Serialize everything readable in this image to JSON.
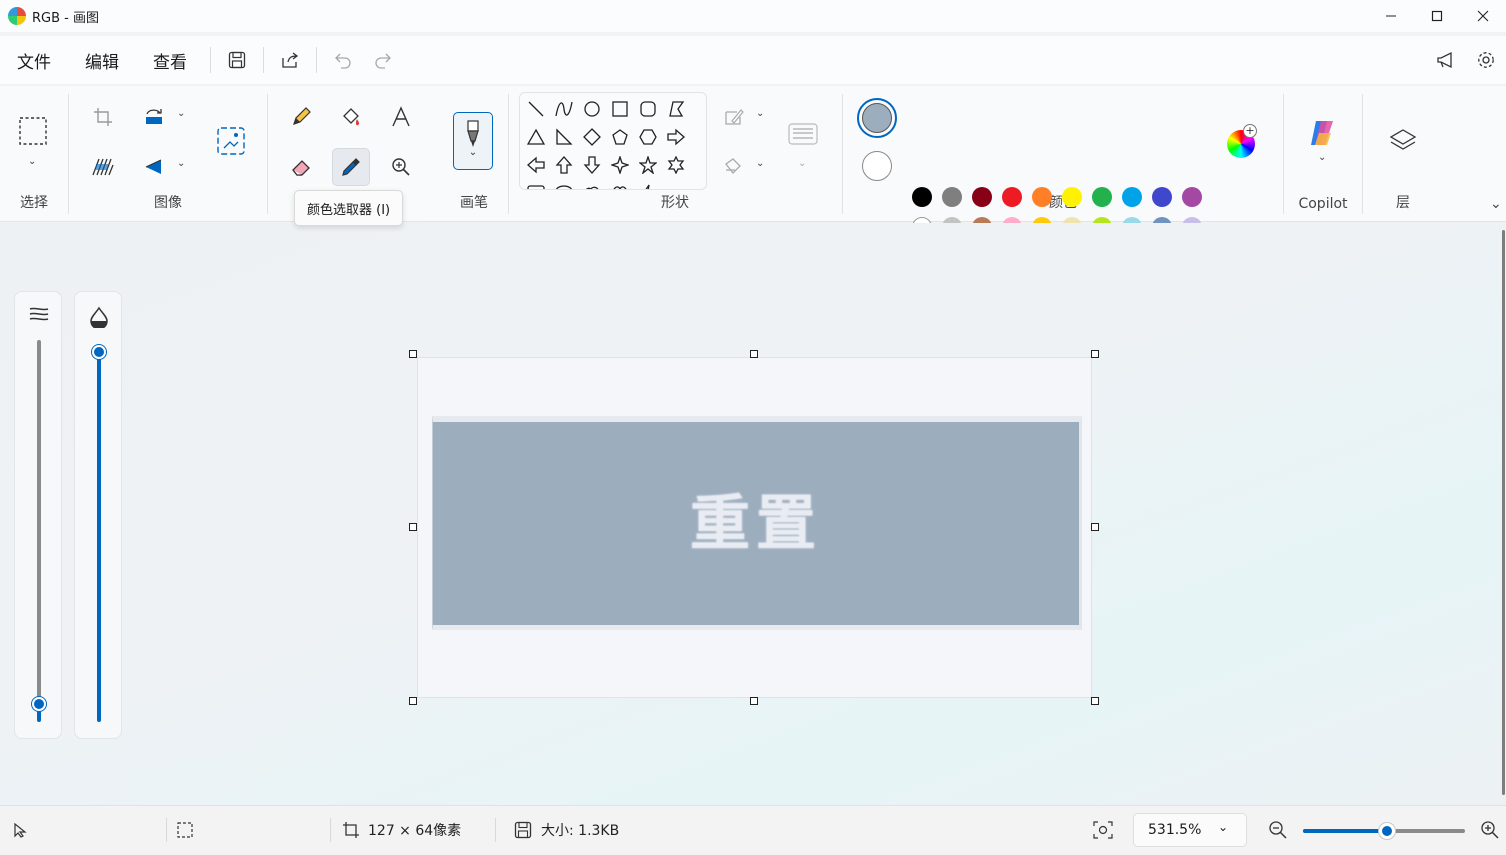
{
  "window": {
    "title": "RGB - 画图"
  },
  "menu": {
    "file": "文件",
    "edit": "编辑",
    "view": "查看"
  },
  "groups": {
    "select": "选择",
    "image": "图像",
    "brushes": "画笔",
    "shapes": "形状",
    "colors": "颜色",
    "copilot": "Copilot",
    "layers": "层"
  },
  "tooltip": "颜色选取器 (I)",
  "colors": {
    "primary": "#9cadbe",
    "secondary": "#ffffff",
    "row1": [
      "#000000",
      "#7f7f7f",
      "#880015",
      "#ed1c24",
      "#ff7f27",
      "#fff200",
      "#22b14c",
      "#00a2e8",
      "#3f48cc",
      "#a349a4"
    ],
    "row2": [
      "#ffffff",
      "#c3c3c3",
      "#b97a57",
      "#ffaec9",
      "#ffc90e",
      "#efe4b0",
      "#b5e61d",
      "#99d9ea",
      "#7092be",
      "#c8bfe7"
    ],
    "accent": "#0067c0"
  },
  "canvas": {
    "text": "重置"
  },
  "sliders": {
    "opacity_level": 1.0,
    "size_level": 0.0
  },
  "status": {
    "dimensions": "127 × 64像素",
    "size": "大小: 1.3KB",
    "zoom": "531.5%",
    "zoom_level": 0.52
  }
}
